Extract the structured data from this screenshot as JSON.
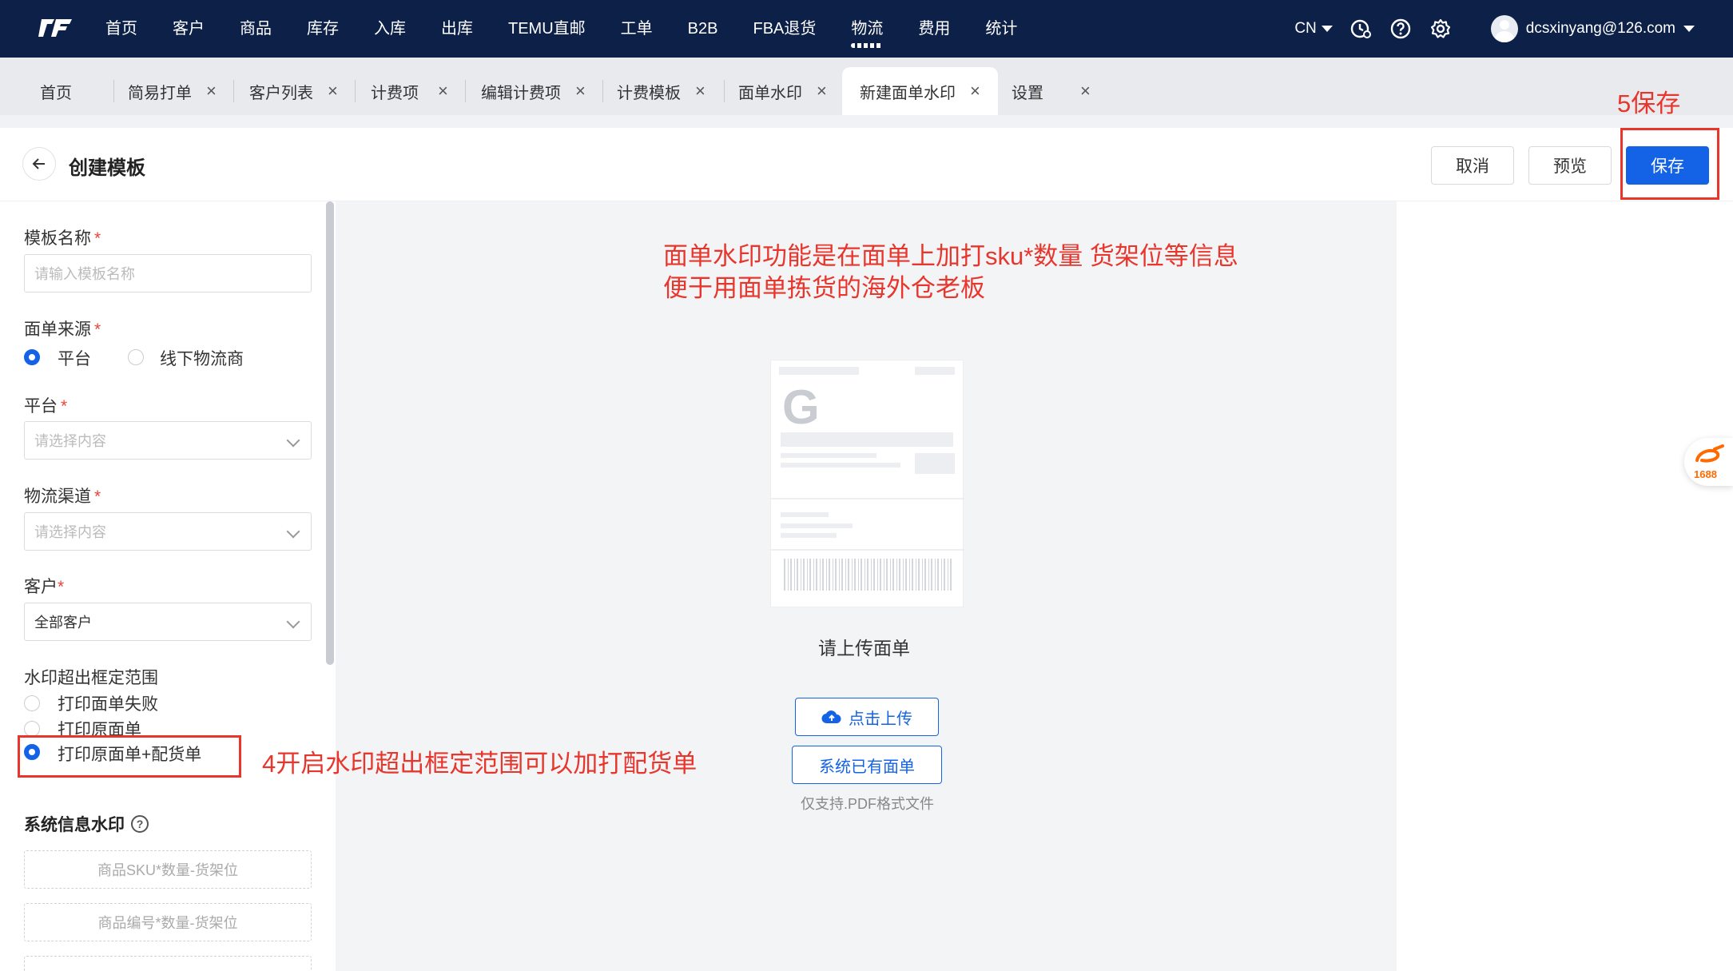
{
  "nav": {
    "items": [
      "首页",
      "客户",
      "商品",
      "库存",
      "入库",
      "出库",
      "TEMU直邮",
      "工单",
      "B2B",
      "FBA退货",
      "物流",
      "费用",
      "统计"
    ],
    "active": "物流",
    "lang": "CN",
    "user_email": "dcsxinyang@126.com"
  },
  "tabs": [
    {
      "label": "首页"
    },
    {
      "label": "简易打单"
    },
    {
      "label": "客户列表"
    },
    {
      "label": "计费项"
    },
    {
      "label": "编辑计费项"
    },
    {
      "label": "计费模板"
    },
    {
      "label": "面单水印"
    },
    {
      "label": "新建面单水印"
    },
    {
      "label": "设置"
    }
  ],
  "tab_close": "×",
  "header": {
    "title": "创建模板",
    "cancel": "取消",
    "preview": "预览",
    "save": "保存"
  },
  "form": {
    "template_name_label": "模板名称",
    "template_name_placeholder": "请输入模板名称",
    "source_label": "面单来源",
    "source_options": [
      "平台",
      "线下物流商"
    ],
    "platform_label": "平台",
    "platform_placeholder": "请选择内容",
    "channel_label": "物流渠道",
    "channel_placeholder": "请选择内容",
    "customer_label": "客户",
    "customer_value": "全部客户",
    "overflow_label": "水印超出框定范围",
    "overflow_options": [
      "打印面单失败",
      "打印原面单",
      "打印原面单+配货单"
    ],
    "system_watermark_title": "系统信息水印",
    "watermark_buttons": [
      "商品SKU*数量-货架位",
      "商品编号*数量-货架位"
    ],
    "required_mark": "*"
  },
  "center": {
    "preview_letter": "G",
    "upload_hint": "请上传面单",
    "upload_button": "点击上传",
    "existing_button": "系统已有面单",
    "pdf_note": "仅支持.PDF格式文件"
  },
  "annotations": {
    "intro_line1": "面单水印功能是在面单上加打sku*数量  货架位等信息",
    "intro_line2": "便于用面单拣货的海外仓老板",
    "step4": "4开启水印超出框定范围可以加打配货单",
    "step5": "5保存"
  },
  "widget": {
    "label": "1688"
  },
  "colors": {
    "nav_bg": "#0c2048",
    "primary": "#1463e6",
    "annotation": "#e8362d"
  }
}
